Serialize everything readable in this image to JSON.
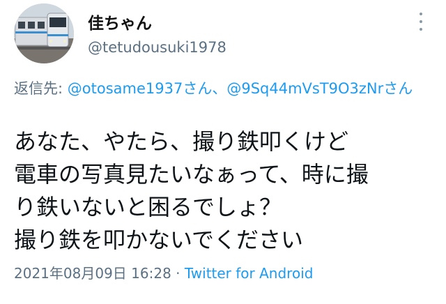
{
  "tweet": {
    "display_name": "佳ちゃん",
    "handle": "@tetudousuki1978",
    "reply_prefix": "返信先: ",
    "mention_1": "@otosame1937さん",
    "mention_separator": "、",
    "mention_2": "@9Sq44mVsT9O3zNrさん",
    "text": "あなた、やたら、撮り鉄叩くけど\n電車の写真見たいなぁって、時に撮\nり鉄いないと困るでしょ？\n撮り鉄を叩かないでください",
    "timestamp": "2021年08月09日 16:28",
    "meta_separator": " · ",
    "source": "Twitter for Android"
  },
  "icons": {
    "more": "more-vertical-icon",
    "avatar": "train-photo-avatar"
  },
  "colors": {
    "link": "#1d9bf0",
    "muted": "#5b7083",
    "text": "#0f1419"
  }
}
